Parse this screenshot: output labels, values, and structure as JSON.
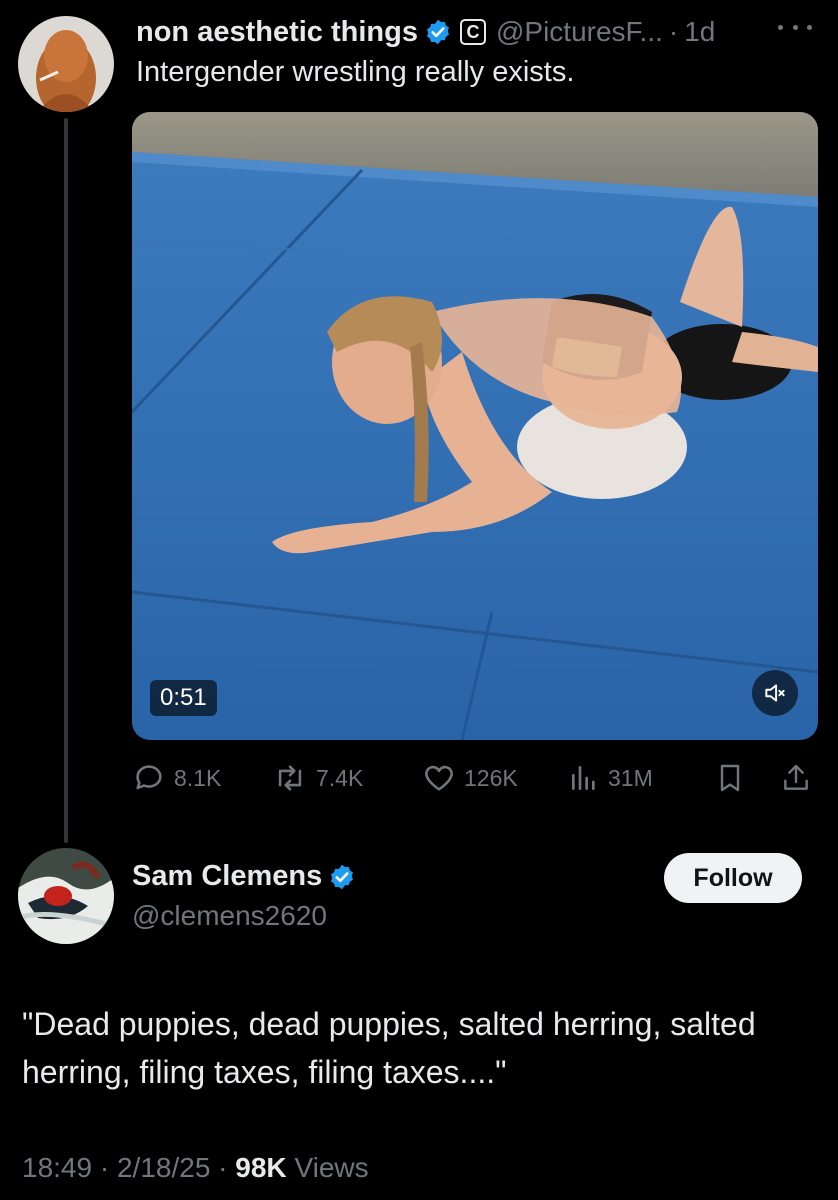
{
  "original_tweet": {
    "display_name": "non aesthetic things",
    "affiliate_badge": "C",
    "handle": "@PicturesF...",
    "separator": "·",
    "time": "1d",
    "text": "Intergender wrestling really exists.",
    "media": {
      "duration": "0:51"
    },
    "actions": {
      "replies": "8.1K",
      "reposts": "7.4K",
      "likes": "126K",
      "views": "31M"
    }
  },
  "reply_tweet": {
    "display_name": "Sam Clemens",
    "handle": "@clemens2620",
    "follow_label": "Follow",
    "text": "\"Dead puppies, dead puppies, salted herring, salted herring, filing taxes, filing taxes....\"",
    "time": "18:49",
    "date": "2/18/25",
    "separator": "·",
    "views_count": "98K",
    "views_label": "Views"
  },
  "icons": {
    "verified": "verified-badge-icon",
    "more": "more-icon",
    "reply": "reply-icon",
    "repost": "repost-icon",
    "like": "heart-icon",
    "views": "views-chart-icon",
    "bookmark": "bookmark-icon",
    "share": "share-icon",
    "mute": "muted-speaker-icon"
  },
  "colors": {
    "background": "#000000",
    "text_primary": "#e7e9ea",
    "text_secondary": "#71767b",
    "verified_blue": "#1d9bf0",
    "mat_blue": "#2f6fb5"
  }
}
